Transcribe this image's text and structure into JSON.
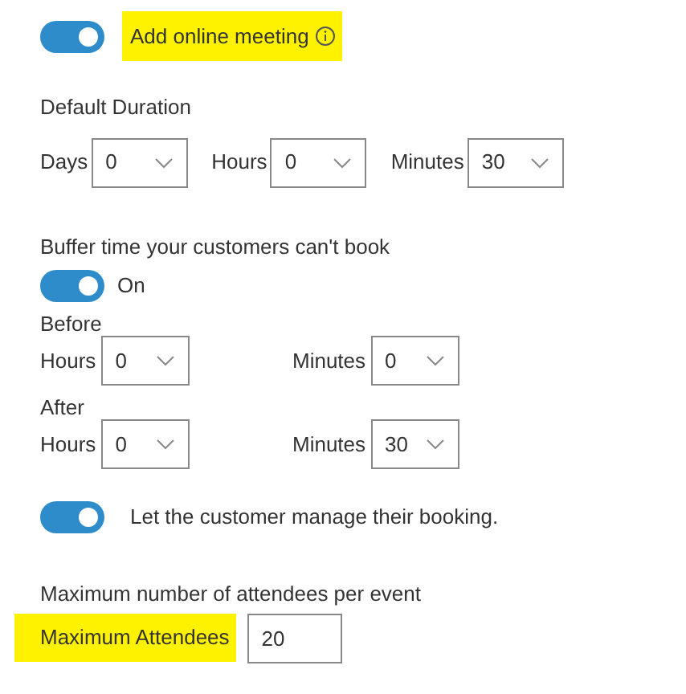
{
  "online_meeting": {
    "on": true,
    "label": "Add online meeting",
    "highlighted": true
  },
  "default_duration": {
    "label": "Default Duration",
    "fields": [
      {
        "label": "Days",
        "value": "0"
      },
      {
        "label": "Hours",
        "value": "0"
      },
      {
        "label": "Minutes",
        "value": "30"
      }
    ]
  },
  "buffer": {
    "label": "Buffer time your customers can't book",
    "on": true,
    "state_label": "On",
    "groups": [
      {
        "label": "Before",
        "fields": [
          {
            "label": "Hours",
            "value": "0"
          },
          {
            "label": "Minutes",
            "value": "0"
          }
        ]
      },
      {
        "label": "After",
        "fields": [
          {
            "label": "Hours",
            "value": "0"
          },
          {
            "label": "Minutes",
            "value": "30"
          }
        ]
      }
    ]
  },
  "manage_booking": {
    "on": true,
    "label": "Let the customer manage their booking."
  },
  "max_attendees": {
    "label": "Maximum number of attendees per event",
    "field_label": "Maximum Attendees",
    "highlighted": true,
    "value": "20"
  }
}
